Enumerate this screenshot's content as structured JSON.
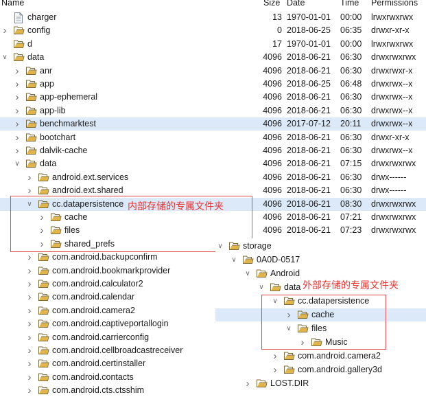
{
  "header": {
    "name": "Name",
    "size": "Size",
    "date": "Date",
    "time": "Time",
    "permissions": "Permissions"
  },
  "rows": [
    {
      "label": "charger",
      "type": "file",
      "size": "13",
      "date": "1970-01-01",
      "time": "00:00",
      "perm": "lrwxrwxrwx"
    },
    {
      "label": "config",
      "type": "folder",
      "chev": "collapsed",
      "size": "0",
      "date": "2018-06-25",
      "time": "06:35",
      "perm": "drwxr-xr-x"
    },
    {
      "label": "d",
      "type": "folder",
      "size": "17",
      "date": "1970-01-01",
      "time": "00:00",
      "perm": "lrwxrwxrwx"
    },
    {
      "label": "data",
      "type": "folder",
      "chev": "expanded",
      "size": "4096",
      "date": "2018-06-21",
      "time": "06:30",
      "perm": "drwxrwxrwx"
    },
    {
      "label": "anr",
      "type": "folder",
      "chev": "collapsed",
      "size": "4096",
      "date": "2018-06-21",
      "time": "06:30",
      "perm": "drwxrwxr-x"
    },
    {
      "label": "app",
      "type": "folder",
      "chev": "collapsed",
      "size": "4096",
      "date": "2018-06-25",
      "time": "06:48",
      "perm": "drwxrwx--x"
    },
    {
      "label": "app-ephemeral",
      "type": "folder",
      "chev": "collapsed",
      "size": "4096",
      "date": "2018-06-21",
      "time": "06:30",
      "perm": "drwxrwx--x"
    },
    {
      "label": "app-lib",
      "type": "folder",
      "chev": "collapsed",
      "size": "4096",
      "date": "2018-06-21",
      "time": "06:30",
      "perm": "drwxrwx--x"
    },
    {
      "label": "benchmarktest",
      "type": "folder",
      "chev": "collapsed",
      "size": "4096",
      "date": "2017-07-12",
      "time": "20:11",
      "perm": "drwxrwx--x",
      "highlight": true
    },
    {
      "label": "bootchart",
      "type": "folder",
      "chev": "collapsed",
      "size": "4096",
      "date": "2018-06-21",
      "time": "06:30",
      "perm": "drwxr-xr-x"
    },
    {
      "label": "dalvik-cache",
      "type": "folder",
      "chev": "collapsed",
      "size": "4096",
      "date": "2018-06-21",
      "time": "06:30",
      "perm": "drwxrwx--x"
    },
    {
      "label": "data",
      "type": "folder",
      "chev": "expanded",
      "size": "4096",
      "date": "2018-06-21",
      "time": "07:15",
      "perm": "drwxrwxrwx"
    },
    {
      "label": "android.ext.services",
      "type": "folder",
      "chev": "collapsed",
      "size": "4096",
      "date": "2018-06-21",
      "time": "06:30",
      "perm": "drwx------"
    },
    {
      "label": "android.ext.shared",
      "type": "folder",
      "chev": "collapsed",
      "size": "4096",
      "date": "2018-06-21",
      "time": "06:30",
      "perm": "drwx------"
    },
    {
      "label": "cc.datapersistence",
      "type": "folder",
      "chev": "expanded",
      "size": "4096",
      "date": "2018-06-21",
      "time": "08:30",
      "perm": "drwxrwxrwx",
      "highlight": true
    },
    {
      "label": "cache",
      "type": "folder",
      "chev": "collapsed",
      "size": "4096",
      "date": "2018-06-21",
      "time": "07:21",
      "perm": "drwxrwxrwx"
    },
    {
      "label": "files",
      "type": "folder",
      "chev": "collapsed",
      "size": "4096",
      "date": "2018-06-21",
      "time": "07:23",
      "perm": "drwxrwxrwx"
    },
    {
      "label": "shared_prefs",
      "type": "folder",
      "chev": "collapsed"
    },
    {
      "label": "com.android.backupconfirm",
      "type": "folder",
      "chev": "collapsed"
    },
    {
      "label": "com.android.bookmarkprovider",
      "type": "folder",
      "chev": "collapsed"
    },
    {
      "label": "com.android.calculator2",
      "type": "folder",
      "chev": "collapsed"
    },
    {
      "label": "com.android.calendar",
      "type": "folder",
      "chev": "collapsed"
    },
    {
      "label": "com.android.camera2",
      "type": "folder",
      "chev": "collapsed"
    },
    {
      "label": "com.android.captiveportallogin",
      "type": "folder",
      "chev": "collapsed"
    },
    {
      "label": "com.android.carrierconfig",
      "type": "folder",
      "chev": "collapsed"
    },
    {
      "label": "com.android.cellbroadcastreceiver",
      "type": "folder",
      "chev": "collapsed"
    },
    {
      "label": "com.android.certinstaller",
      "type": "folder",
      "chev": "collapsed"
    },
    {
      "label": "com.android.contacts",
      "type": "folder",
      "chev": "collapsed"
    },
    {
      "label": "com.android.cts.ctsshim",
      "type": "folder",
      "chev": "collapsed"
    }
  ],
  "annotation_internal": "内部存储的专属文件夹",
  "annotation_external": "外部存储的专属文件夹",
  "popup_rows": [
    {
      "label": "storage",
      "chev": "expanded"
    },
    {
      "label": "0A0D-0517",
      "chev": "expanded"
    },
    {
      "label": "Android",
      "chev": "expanded"
    },
    {
      "label": "data",
      "chev": "expanded"
    },
    {
      "label": "cc.datapersistence",
      "chev": "expanded"
    },
    {
      "label": "cache",
      "chev": "collapsed",
      "highlight": true
    },
    {
      "label": "files",
      "chev": "expanded"
    },
    {
      "label": "Music",
      "chev": "collapsed"
    },
    {
      "label": "com.android.camera2",
      "chev": "collapsed"
    },
    {
      "label": "com.android.gallery3d",
      "chev": "collapsed"
    },
    {
      "label": "LOST.DIR",
      "chev": "collapsed"
    }
  ],
  "colors": {
    "highlight": "#dbe9f9",
    "folder": "#e2b54a",
    "annotation": "#e8332f"
  }
}
